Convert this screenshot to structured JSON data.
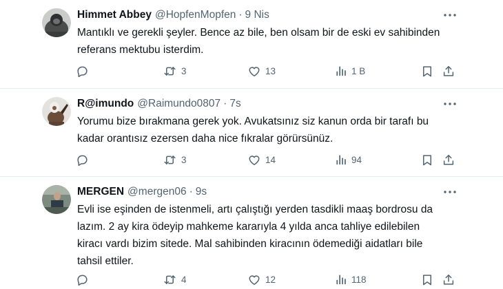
{
  "tweets": [
    {
      "name": "Himmet Abbey",
      "handle": "@HopfenMopfen",
      "separator": "·",
      "time": "9 Nis",
      "lines": [
        "Mantıklı ve gerekli şeyler. Bence az bile, ben olsam bir de eski ev sahibinden",
        "referans mektubu isterdim."
      ],
      "retweets": "3",
      "likes": "13",
      "views": "1 B"
    },
    {
      "name": "R@imundo",
      "handle": "@Raimundo0807",
      "separator": "·",
      "time": "7s",
      "lines": [
        "Yorumu bize bırakmana gerek yok. Avukatsınız siz kanun orda bir tarafı bu",
        "kadar orantısız ezersen daha nice fıkralar görürsünüz."
      ],
      "retweets": "3",
      "likes": "14",
      "views": "94"
    },
    {
      "name": "MERGEN",
      "handle": "@mergen06",
      "separator": "·",
      "time": "9s",
      "lines": [
        "Evli ise eşinden de istenmeli, artı çalıştığı yerden tasdikli maaş bordrosu da",
        "lazım. 2 ay kira ödeyip mahkeme kararıyla 4 yılda anca tahliye edilebilen",
        "kiracı vardı bizim sitede. Mal sahibinden kiracının ödemediği aidatları bile",
        "tahsil ettiler."
      ],
      "retweets": "4",
      "likes": "12",
      "views": "118"
    }
  ],
  "icons": {
    "reply": "reply-icon",
    "retweet": "retweet-icon",
    "like": "heart-icon",
    "views": "views-icon",
    "bookmark": "bookmark-icon",
    "share": "share-icon",
    "more": "more-options-icon"
  },
  "colors": {
    "text": "#0f1419",
    "secondary": "#536471",
    "divider": "#e6ecf0",
    "background": "#ffffff"
  }
}
